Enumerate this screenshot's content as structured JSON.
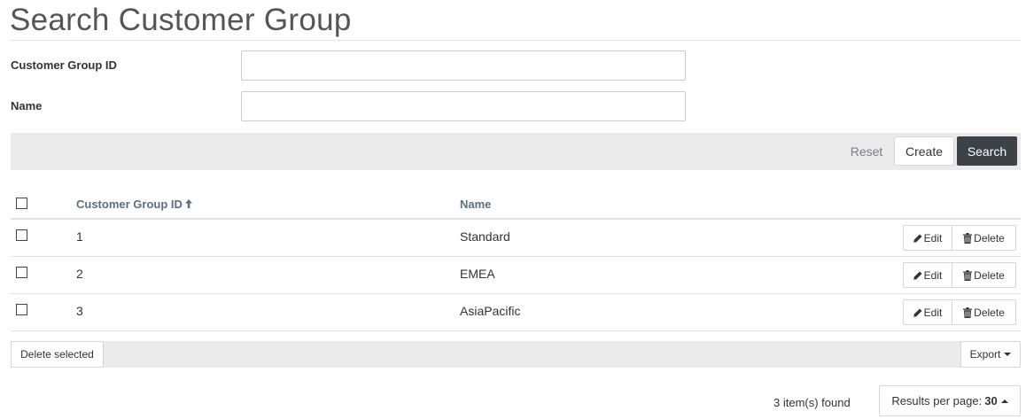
{
  "page": {
    "title": "Search Customer Group"
  },
  "form": {
    "fields": [
      {
        "label": "Customer Group ID",
        "value": "",
        "placeholder": ""
      },
      {
        "label": "Name",
        "value": "",
        "placeholder": ""
      }
    ]
  },
  "actions": {
    "reset_label": "Reset",
    "create_label": "Create",
    "search_label": "Search"
  },
  "grid": {
    "columns": {
      "id": "Customer Group ID",
      "name": "Name"
    },
    "sort_icon": "arrow-up-icon",
    "rows": [
      {
        "id": "1",
        "name": "Standard",
        "edit_label": "Edit",
        "delete_label": "Delete"
      },
      {
        "id": "2",
        "name": "EMEA",
        "edit_label": "Edit",
        "delete_label": "Delete"
      },
      {
        "id": "3",
        "name": "AsiaPacific",
        "edit_label": "Edit",
        "delete_label": "Delete"
      }
    ]
  },
  "bottom": {
    "delete_selected_label": "Delete selected",
    "export_label": "Export",
    "items_found": "3 item(s) found",
    "results_per_page_label": "Results per page:",
    "results_per_page_value": "30"
  },
  "colors": {
    "accent_dark": "#3d4249",
    "header_text": "#5c6f80",
    "bar_background": "#ebebeb"
  }
}
